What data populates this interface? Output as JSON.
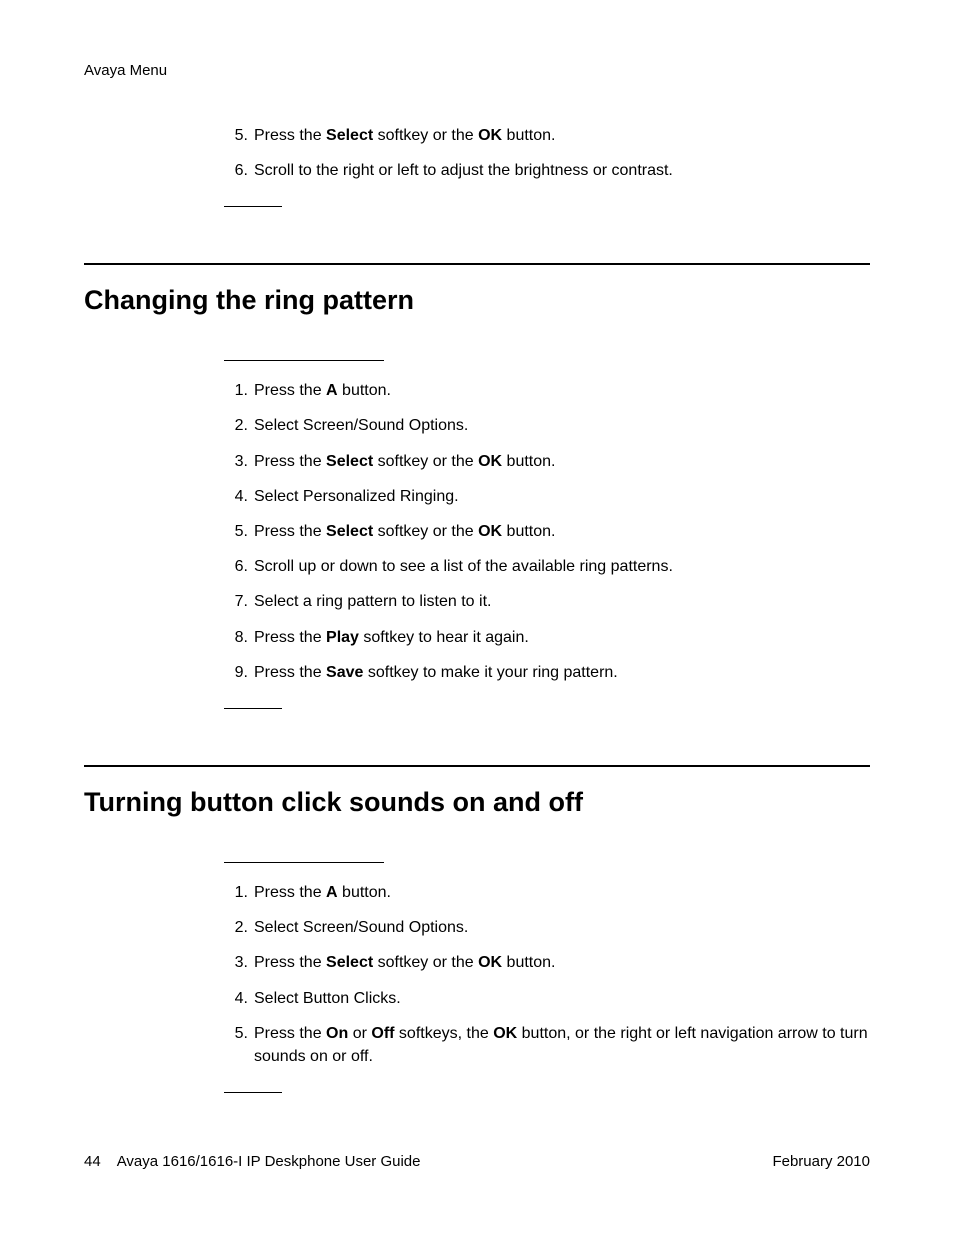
{
  "header": {
    "title": "Avaya Menu"
  },
  "intro_steps": [
    {
      "n": "5.",
      "segs": [
        "Press the ",
        {
          "b": "Select"
        },
        " softkey or the ",
        {
          "b": "OK"
        },
        " button."
      ]
    },
    {
      "n": "6.",
      "segs": [
        "Scroll to the right or left to adjust the brightness or contrast."
      ]
    }
  ],
  "section1": {
    "heading": "Changing the ring pattern",
    "steps": [
      {
        "n": "1.",
        "segs": [
          "Press the ",
          {
            "b": "A"
          },
          " button."
        ]
      },
      {
        "n": "2.",
        "segs": [
          "Select Screen/Sound Options."
        ]
      },
      {
        "n": "3.",
        "segs": [
          "Press the ",
          {
            "b": "Select"
          },
          " softkey or the ",
          {
            "b": "OK"
          },
          " button."
        ]
      },
      {
        "n": "4.",
        "segs": [
          "Select Personalized Ringing."
        ]
      },
      {
        "n": "5.",
        "segs": [
          "Press the ",
          {
            "b": "Select"
          },
          " softkey or the ",
          {
            "b": "OK"
          },
          " button."
        ]
      },
      {
        "n": "6.",
        "segs": [
          "Scroll up or down to see a list of the available ring patterns."
        ]
      },
      {
        "n": "7.",
        "segs": [
          "Select a ring pattern to listen to it."
        ]
      },
      {
        "n": "8.",
        "segs": [
          "Press the ",
          {
            "b": "Play"
          },
          " softkey to hear it again."
        ]
      },
      {
        "n": "9.",
        "segs": [
          "Press the ",
          {
            "b": "Save"
          },
          " softkey to make it your ring pattern."
        ]
      }
    ]
  },
  "section2": {
    "heading": "Turning button click sounds on and off",
    "steps": [
      {
        "n": "1.",
        "segs": [
          "Press the ",
          {
            "b": "A"
          },
          " button."
        ]
      },
      {
        "n": "2.",
        "segs": [
          "Select Screen/Sound Options."
        ]
      },
      {
        "n": "3.",
        "segs": [
          "Press the ",
          {
            "b": "Select"
          },
          " softkey or the ",
          {
            "b": "OK"
          },
          " button."
        ]
      },
      {
        "n": "4.",
        "segs": [
          "Select Button Clicks."
        ]
      },
      {
        "n": "5.",
        "segs": [
          "Press the ",
          {
            "b": "On"
          },
          " or ",
          {
            "b": "Off"
          },
          " softkeys, the ",
          {
            "b": "OK"
          },
          " button, or the right or left navigation arrow to turn sounds on or off."
        ]
      }
    ]
  },
  "footer": {
    "page": "44",
    "title": "Avaya 1616/1616-I IP Deskphone User Guide",
    "date": "February 2010"
  }
}
